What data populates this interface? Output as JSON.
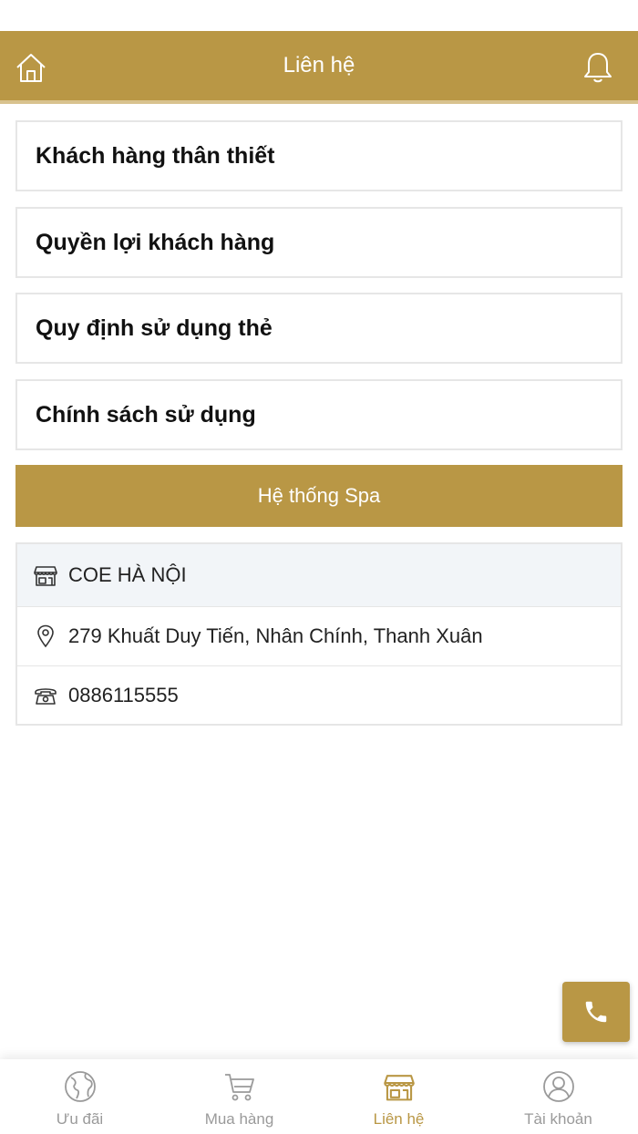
{
  "header": {
    "title": "Liên hệ"
  },
  "menu": [
    {
      "label": "Khách hàng thân thiết"
    },
    {
      "label": "Quyền lợi khách hàng"
    },
    {
      "label": "Quy định sử dụng thẻ"
    },
    {
      "label": "Chính sách sử dụng"
    }
  ],
  "spa_button": {
    "label": "Hệ thống Spa"
  },
  "spa": {
    "name": "COE HÀ NỘI",
    "address": "279 Khuất Duy Tiến, Nhân Chính, Thanh Xuân",
    "phone": "0886115555"
  },
  "tabs": [
    {
      "label": "Ưu đãi",
      "icon": "globe-icon"
    },
    {
      "label": "Mua hàng",
      "icon": "cart-icon"
    },
    {
      "label": "Liên hệ",
      "icon": "store-icon",
      "active": true
    },
    {
      "label": "Tài khoản",
      "icon": "user-icon"
    }
  ],
  "colors": {
    "accent": "#b99745",
    "inactive": "#9a9a9a"
  }
}
